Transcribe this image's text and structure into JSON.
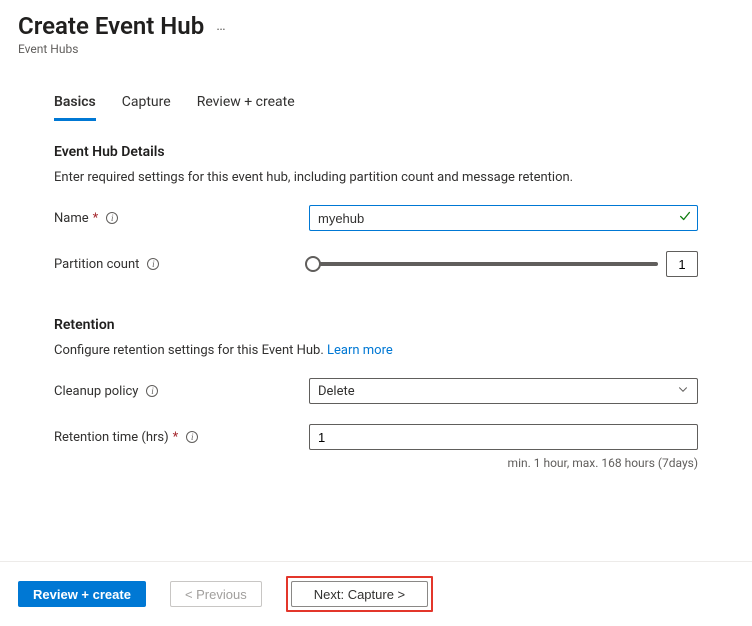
{
  "header": {
    "title": "Create Event Hub",
    "breadcrumb": "Event Hubs",
    "ellipsis": "…"
  },
  "tabs": {
    "basics": "Basics",
    "capture": "Capture",
    "review": "Review + create"
  },
  "details": {
    "heading": "Event Hub Details",
    "description": "Enter required settings for this event hub, including partition count and message retention.",
    "name_label": "Name",
    "name_value": "myehub",
    "partition_label": "Partition count",
    "partition_value": "1"
  },
  "retention": {
    "heading": "Retention",
    "description_a": "Configure retention settings for this Event Hub. ",
    "learn_more": "Learn more",
    "cleanup_label": "Cleanup policy",
    "cleanup_value": "Delete",
    "time_label": "Retention time (hrs)",
    "time_value": "1",
    "hint": "min. 1 hour, max. 168 hours (7days)"
  },
  "footer": {
    "review": "Review + create",
    "previous": "< Previous",
    "next": "Next: Capture >"
  }
}
